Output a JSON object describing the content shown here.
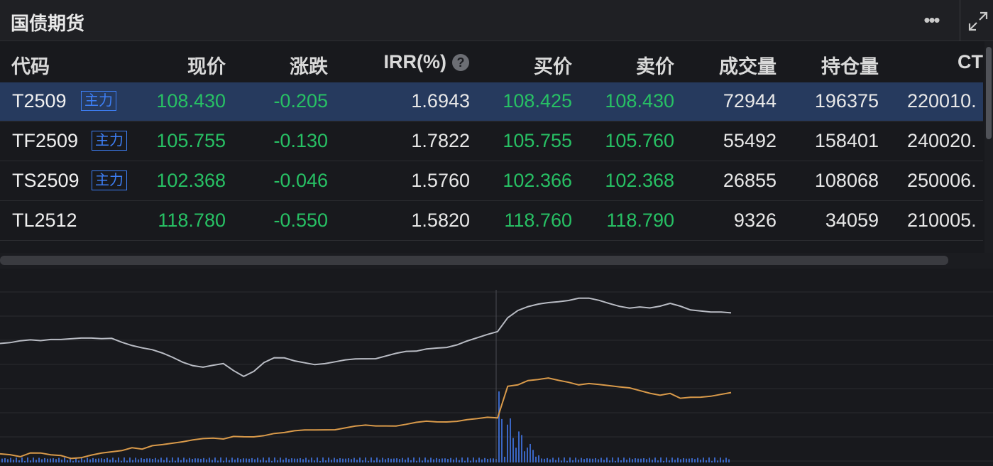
{
  "header": {
    "title": "国债期货",
    "more_icon": "more-icon",
    "expand_icon": "expand-icon"
  },
  "columns": {
    "code": "代码",
    "price": "现价",
    "change": "涨跌",
    "irr": "IRR(%)",
    "bid": "买价",
    "ask": "卖价",
    "volume": "成交量",
    "oi": "持仓量",
    "ctd": "CT"
  },
  "rows": [
    {
      "code": "T2509",
      "badge": "主力",
      "price": "108.430",
      "change": "-0.205",
      "irr": "1.6943",
      "bid": "108.425",
      "ask": "108.430",
      "volume": "72944",
      "oi": "196375",
      "ctd": "220010."
    },
    {
      "code": "TF2509",
      "badge": "主力",
      "price": "105.755",
      "change": "-0.130",
      "irr": "1.7822",
      "bid": "105.755",
      "ask": "105.760",
      "volume": "55492",
      "oi": "158401",
      "ctd": "240020."
    },
    {
      "code": "TS2509",
      "badge": "主力",
      "price": "102.368",
      "change": "-0.046",
      "irr": "1.5760",
      "bid": "102.366",
      "ask": "102.368",
      "volume": "26855",
      "oi": "108068",
      "ctd": "250006."
    },
    {
      "code": "TL2512",
      "badge": "",
      "price": "118.780",
      "change": "-0.550",
      "irr": "1.5820",
      "bid": "118.760",
      "ask": "118.790",
      "volume": "9326",
      "oi": "34059",
      "ctd": "210005."
    }
  ],
  "colors": {
    "up_green": "#27c064",
    "badge_blue": "#3d7ff5",
    "selected_row": "#263a5e",
    "price_line": "#b9bcc4",
    "avg_line": "#d99a4a",
    "volume_bar": "#3a66c4"
  },
  "chart_data": {
    "type": "line",
    "series": [
      {
        "values": [
          0.9,
          0.9,
          0.7,
          1.0,
          0.9,
          0.7,
          0.7,
          0.5,
          0.6,
          0.8,
          0.9,
          1.0,
          1.2,
          1.6,
          1.5,
          1.8,
          1.8,
          1.9,
          2.1,
          2.4,
          2.6,
          2.6,
          2.4,
          2.6,
          2.6,
          2.7,
          2.9,
          3.1,
          3.1,
          3.2,
          3.3,
          3.4,
          3.5,
          3.5,
          3.6,
          3.7,
          3.8,
          3.8,
          3.9,
          3.9,
          4.0,
          4.1,
          4.2,
          4.2,
          4.3,
          4.4,
          4.5,
          4.5,
          4.6,
          4.6,
          8.0,
          8.2,
          8.6,
          8.6,
          8.7,
          8.5,
          8.4,
          8.2,
          8.3,
          8.1,
          7.9,
          7.8,
          7.8,
          7.6,
          7.3,
          7.0,
          7.1,
          6.6,
          6.8,
          6.9,
          7.0,
          7.1,
          7.2
        ]
      },
      {
        "values": [
          12.5,
          12.6,
          12.7,
          12.7,
          12.6,
          12.8,
          12.9,
          13.0,
          13.0,
          12.9,
          12.8,
          12.9,
          12.6,
          12.3,
          12.0,
          11.7,
          11.3,
          10.9,
          10.5,
          10.2,
          10.0,
          10.1,
          10.2,
          9.5,
          9.0,
          9.6,
          10.5,
          10.9,
          10.8,
          10.5,
          10.4,
          10.3,
          10.4,
          10.5,
          10.6,
          10.7,
          10.8,
          10.9,
          11.2,
          11.4,
          11.5,
          11.5,
          11.8,
          12.0,
          12.1,
          12.3,
          12.6,
          12.9,
          13.3,
          13.7,
          15.2,
          15.9,
          16.2,
          16.4,
          16.6,
          16.8,
          17.0,
          17.2,
          17.1,
          16.8,
          16.5,
          16.3,
          16.2,
          16.3,
          16.1,
          16.2,
          16.5,
          16.3,
          16.0,
          15.9,
          15.7,
          15.6,
          15.5
        ]
      }
    ]
  }
}
